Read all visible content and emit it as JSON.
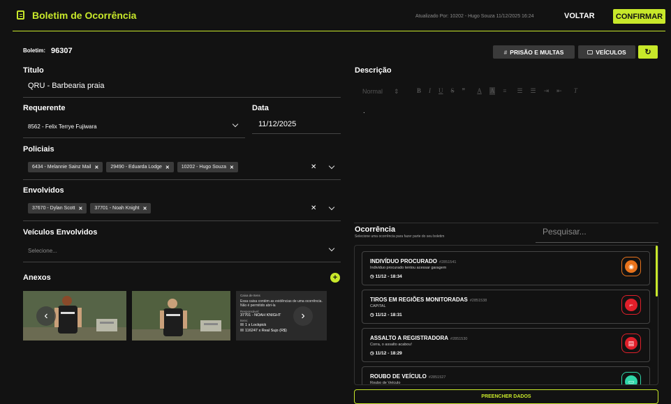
{
  "header": {
    "title": "Boletim de Ocorrência",
    "updated_by": "Atualizado Por: 10202 - Hugo Souza 11/12/2025 16:24",
    "voltar_label": "VOLTAR",
    "confirmar_label": "CONFIRMAR"
  },
  "colors": {
    "accent": "#c8e82a",
    "background": "#121212"
  },
  "boletim": {
    "label": "Boletim:",
    "number": "96307"
  },
  "titulo": {
    "label": "Titulo",
    "value": "QRU - Barbearia praia"
  },
  "requerente": {
    "label": "Requerente",
    "value": "8562 - Felix Terrye Fujiwara"
  },
  "data": {
    "label": "Data",
    "value": "11/12/2025"
  },
  "policiais": {
    "label": "Policiais",
    "chips": [
      "6434 - Melannie Sainz Mail",
      "29490 - Eduarda Lodge",
      "10202 - Hugo Souza"
    ]
  },
  "envolvidos": {
    "label": "Envolvidos",
    "chips": [
      "37670 - Dylan Scott",
      "37701 - Noah Knight"
    ]
  },
  "veiculos_envolvidos": {
    "label": "Veículos Envolvidos",
    "placeholder": "Selecione..."
  },
  "anexos": {
    "label": "Anexos",
    "thumb3": {
      "heading": "Caixa de Itens",
      "text": "Essa caixa contém as evidências de uma ocorrência. Não é permitido abri-la",
      "owner_label": "Responsável:",
      "owner": "37701 - NOAH KNIGHT",
      "items_label": "Itens:",
      "items": [
        "1 x Lockpick",
        "116247 x Real Sujo (R$)"
      ]
    }
  },
  "actions": {
    "prisao_label": "PRISÃO E MULTAS",
    "veiculos_label": "VEÍCULOS"
  },
  "descricao": {
    "label": "Descrição",
    "format_select": "Normal",
    "content": "."
  },
  "ocorrencia": {
    "label": "Ocorrência",
    "hint": "Selecione uma ocorrência para fazer parte do seu boletim",
    "search_placeholder": "Pesquisar...",
    "items": [
      {
        "title": "INDIVÍDUO PROCURADO",
        "code": "#2851541",
        "subtitle": "Individuo procurado tentou acessar garagem",
        "time": "11/12 - 18:34",
        "color": "#e8731c",
        "icon": "target-icon"
      },
      {
        "title": "TIROS EM REGIÕES MONITORADAS",
        "code": "#2851538",
        "subtitle": "CAPITAL",
        "time": "11/12 - 18:31",
        "color": "#e01f2a",
        "icon": "gun-icon"
      },
      {
        "title": "ASSALTO A REGISTRADORA",
        "code": "#2851530",
        "subtitle": "Corra, o assalto acabou!",
        "time": "11/12 - 18:29",
        "color": "#e01f2a",
        "icon": "register-icon"
      },
      {
        "title": "ROUBO DE VEÍCULO",
        "code": "#2851527",
        "subtitle": "Roubo de Veículo",
        "time": "",
        "color": "#2fd6a8",
        "icon": "car-icon"
      }
    ],
    "fill_button": "PREENCHER DADOS"
  }
}
